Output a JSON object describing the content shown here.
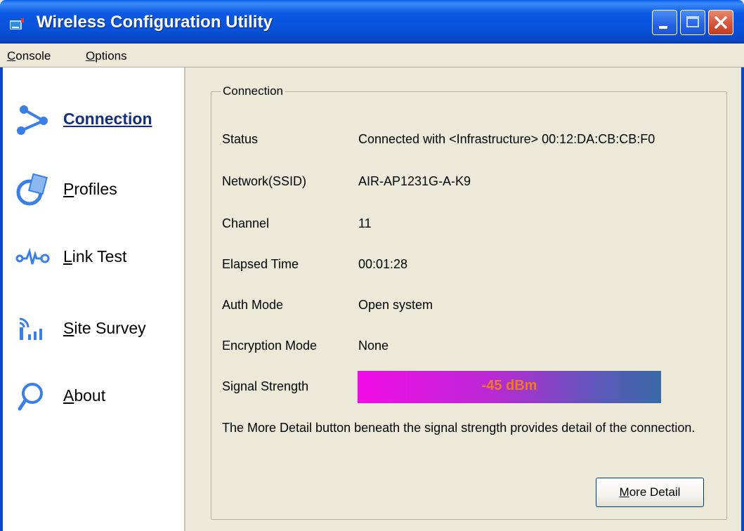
{
  "window": {
    "title": "Wireless Configuration Utility",
    "controls": [
      "minimize",
      "maximize",
      "close"
    ]
  },
  "menu": {
    "items": [
      {
        "label": "Console",
        "accel": "C"
      },
      {
        "label": "Options",
        "accel": "O"
      }
    ]
  },
  "sidebar": {
    "items": [
      {
        "label": "Connection",
        "icon": "connection-icon",
        "active": true
      },
      {
        "label": "Profiles",
        "icon": "profiles-icon",
        "active": false
      },
      {
        "label": "Link Test",
        "icon": "link-test-icon",
        "active": false
      },
      {
        "label": "Site Survey",
        "icon": "site-survey-icon",
        "active": false
      },
      {
        "label": "About",
        "icon": "about-icon",
        "active": false
      }
    ]
  },
  "connection": {
    "group_title": "Connection",
    "rows": [
      {
        "label": "Status",
        "value": "Connected with <Infrastructure> 00:12:DA:CB:CB:F0"
      },
      {
        "label": "Network(SSID)",
        "value": "AIR-AP1231G-A-K9"
      },
      {
        "label": "Channel",
        "value": "11"
      },
      {
        "label": "Elapsed Time",
        "value": "00:01:28"
      },
      {
        "label": "Auth Mode",
        "value": "Open system"
      },
      {
        "label": "Encryption Mode",
        "value": "None"
      }
    ],
    "signal": {
      "label": "Signal Strength",
      "value": "-45 dBm"
    },
    "note": "The More Detail button beneath the signal strength provides detail of the connection.",
    "more_detail_button": "More Detail"
  },
  "colors": {
    "titlebar": "#0850d6",
    "signal_start": "#f40ce8",
    "signal_end": "#3a6aa8",
    "signal_text": "#f07a1c",
    "active_nav": "#14307a"
  }
}
